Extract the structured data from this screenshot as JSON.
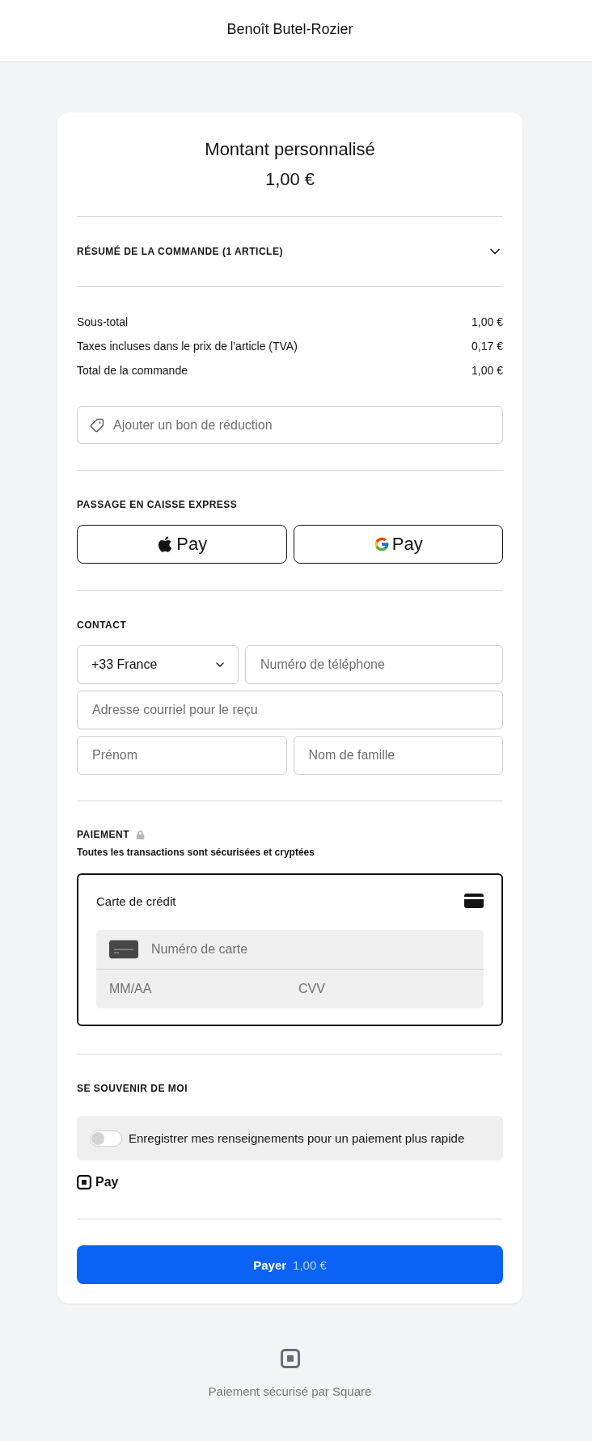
{
  "header": {
    "merchant_name": "Benoît Butel-Rozier"
  },
  "item": {
    "title": "Montant personnalisé",
    "amount": "1,00 €"
  },
  "order_summary": {
    "label": "RÉSUMÉ DE LA COMMANDE (1 ARTICLE)",
    "expanded": false
  },
  "totals": [
    {
      "label": "Sous-total",
      "value": "1,00 €"
    },
    {
      "label": "Taxes incluses dans le prix de l’article (TVA)",
      "value": "0,17 €"
    },
    {
      "label": "Total de la commande",
      "value": "1,00 €"
    }
  ],
  "coupon": {
    "placeholder": "Ajouter un bon de réduction"
  },
  "express_checkout": {
    "heading": "PASSAGE EN CAISSE EXPRESS",
    "buttons": [
      {
        "kind": "apple",
        "label": "Pay"
      },
      {
        "kind": "google",
        "label": "Pay"
      }
    ]
  },
  "contact": {
    "heading": "CONTACT",
    "country": {
      "value": "+33 France"
    },
    "phone": {
      "placeholder": "Numéro de téléphone"
    },
    "email": {
      "placeholder": "Adresse courriel pour le reçu"
    },
    "first_name": {
      "placeholder": "Prénom"
    },
    "last_name": {
      "placeholder": "Nom de famille"
    }
  },
  "payment": {
    "heading": "PAIEMENT",
    "subtitle": "Toutes les transactions sont sécurisées et cryptées",
    "method": {
      "label": "Carte de crédit",
      "selected": true
    },
    "card_number": {
      "placeholder": "Numéro de carte"
    },
    "expiry": {
      "placeholder": "MM/AA"
    },
    "cvv": {
      "placeholder": "CVV"
    }
  },
  "remember_me": {
    "heading": "SE SOUVENIR DE MOI",
    "toggle": {
      "label": "Enregistrer mes renseignements pour un paiement plus rapide",
      "on": false
    },
    "brand_label": "Pay"
  },
  "pay_button": {
    "label": "Payer",
    "amount": "1,00 €"
  },
  "footer": {
    "text": "Paiement sécurisé par Square"
  }
}
